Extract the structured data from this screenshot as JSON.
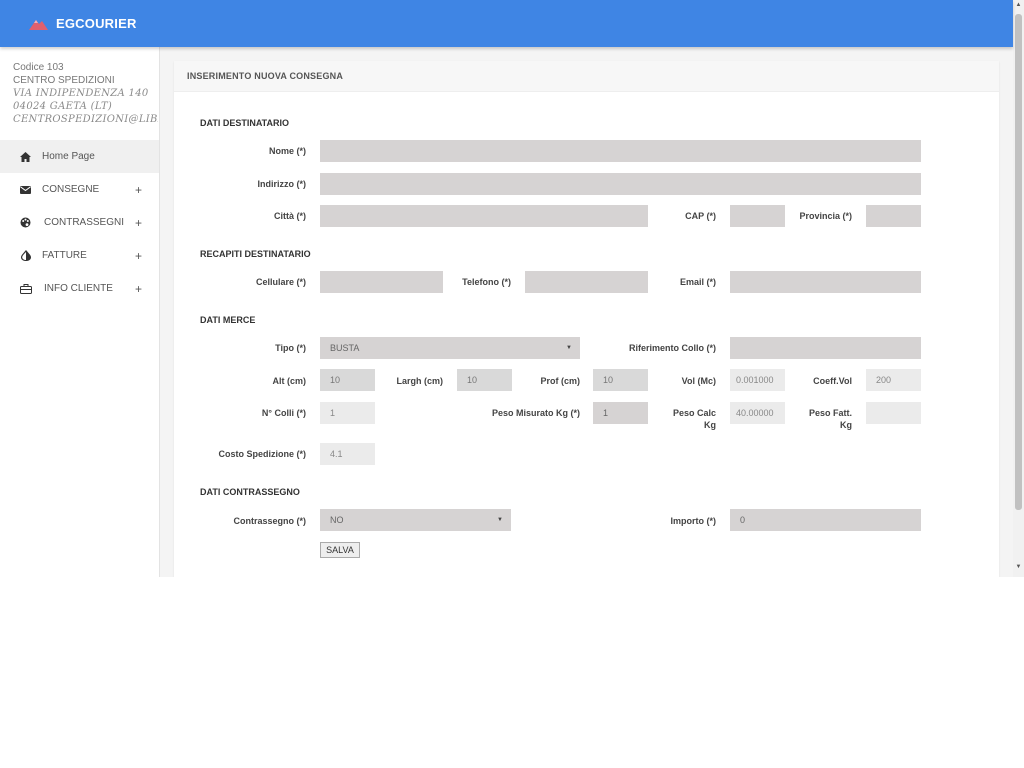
{
  "app": {
    "brand": "EGCOURIER",
    "brand_color": "#3f85e4",
    "logo_color": "#e0606e"
  },
  "client": {
    "code": "Codice 103",
    "name": "CENTRO SPEDIZIONI",
    "address": "VIA INDIPENDENZA 140",
    "city": "04024 GAETA (LT)",
    "email": "CENTROSPEDIZIONI@LIBERO.IT"
  },
  "sidebar": {
    "items": [
      {
        "label": "Home Page",
        "icon": "home-icon",
        "expandable": false,
        "active": true
      },
      {
        "label": "CONSEGNE",
        "icon": "envelope-icon",
        "expandable": true,
        "plus": "+"
      },
      {
        "label": "CONTRASSEGNI",
        "icon": "palette-icon",
        "expandable": true,
        "plus": "+"
      },
      {
        "label": "FATTURE",
        "icon": "contrast-icon",
        "expandable": true,
        "plus": "+"
      },
      {
        "label": "INFO CLIENTE",
        "icon": "briefcase-icon",
        "expandable": true,
        "plus": "+"
      }
    ]
  },
  "panel": {
    "title": "INSERIMENTO NUOVA CONSEGNA"
  },
  "form": {
    "sections": {
      "destinatario": "DATI DESTINATARIO",
      "recapiti": "RECAPITI DESTINATARIO",
      "merce": "DATI MERCE",
      "contrassegno": "DATI CONTRASSEGNO"
    },
    "labels": {
      "nome": "Nome (*)",
      "indirizzo": "Indirizzo (*)",
      "citta": "Città (*)",
      "cap": "CAP (*)",
      "provincia": "Provincia (*)",
      "cellulare": "Cellulare (*)",
      "telefono": "Telefono (*)",
      "email": "Email (*)",
      "tipo": "Tipo (*)",
      "riferimento": "Riferimento Collo (*)",
      "alt": "Alt (cm)",
      "largh": "Largh (cm)",
      "prof": "Prof (cm)",
      "vol": "Vol (Mc)",
      "coeff": "Coeff.Vol",
      "colli": "N° Colli (*)",
      "peso_misurato": "Peso Misurato Kg (*)",
      "peso_calc_1": "Peso Calc",
      "peso_calc_2": "Kg",
      "peso_fatt_1": "Peso Fatt.",
      "peso_fatt_2": "Kg",
      "costo": "Costo Spedizione (*)",
      "contrassegno": "Contrassegno (*)",
      "importo": "Importo (*)"
    },
    "values": {
      "nome": "",
      "indirizzo": "",
      "citta": "",
      "cap": "",
      "provincia": "",
      "cellulare": "",
      "telefono": "",
      "email": "",
      "tipo": "BUSTA",
      "riferimento": "",
      "alt": "10",
      "largh": "10",
      "prof": "10",
      "vol": "0.001000",
      "coeff": "200",
      "colli": "1",
      "peso_misurato": "1",
      "peso_calc": "40.00000",
      "peso_fatt": "",
      "costo": "4.1",
      "contrassegno": "NO",
      "importo": "0"
    },
    "save_label": "SALVA"
  }
}
